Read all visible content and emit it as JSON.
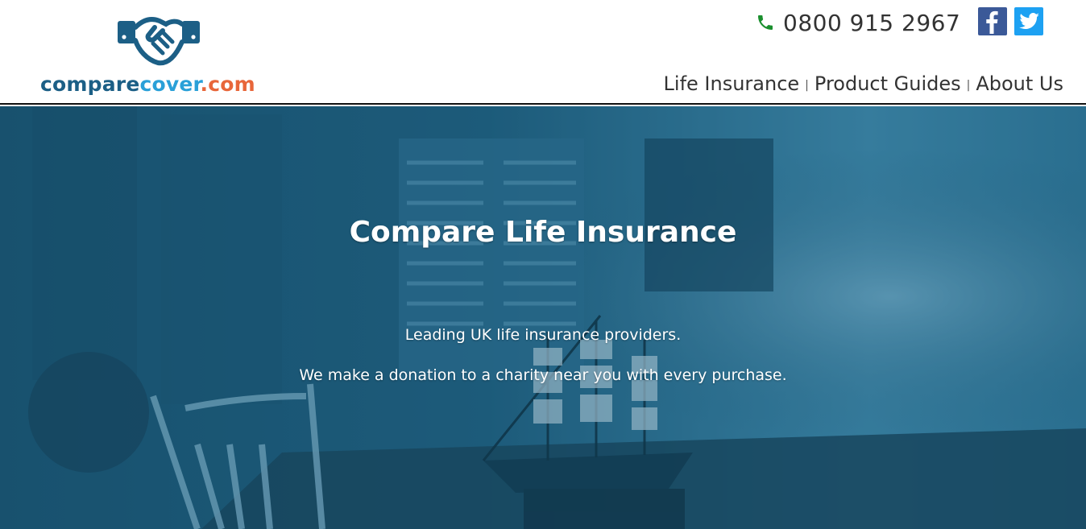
{
  "brand": {
    "part1": "compare",
    "part2": "cover",
    "part3": ".com",
    "colors": {
      "dark": "#1c5f86",
      "light": "#2aa0d8",
      "accent": "#e8663a"
    },
    "icon": "handshake-icon"
  },
  "contact": {
    "phone": "0800 915 2967",
    "phone_icon": "phone-icon",
    "phone_icon_color": "#1a8f2e"
  },
  "social": [
    {
      "name": "facebook",
      "icon": "facebook-icon",
      "color": "#3b5998"
    },
    {
      "name": "twitter",
      "icon": "twitter-icon",
      "color": "#1da1f2"
    }
  ],
  "nav": {
    "items": [
      "Life Insurance",
      "Product Guides",
      "About Us"
    ],
    "separator": "|"
  },
  "hero": {
    "title": "Compare Life Insurance",
    "line1": "Leading UK life insurance providers.",
    "line2": "We make a donation to a charity near you with every purchase.",
    "overlay_color": "#1d5b7a"
  }
}
